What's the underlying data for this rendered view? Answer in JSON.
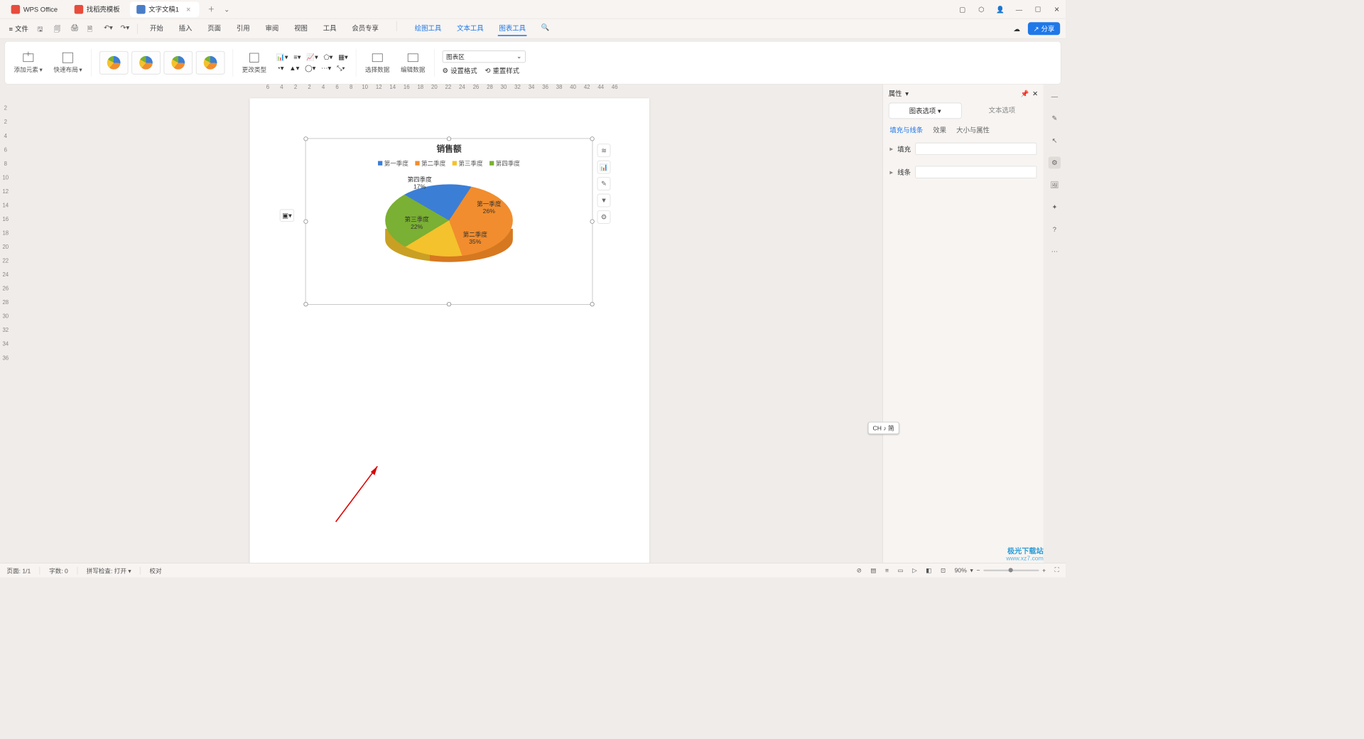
{
  "titlebar": {
    "tabs": [
      {
        "label": "WPS Office",
        "icon": "wps"
      },
      {
        "label": "找稻壳模板",
        "icon": "tpl"
      },
      {
        "label": "文字文稿1",
        "icon": "doc",
        "active": true
      }
    ]
  },
  "menubar": {
    "file": "文件",
    "items": [
      "开始",
      "插入",
      "页面",
      "引用",
      "审阅",
      "视图",
      "工具",
      "会员专享"
    ],
    "blue_items": [
      "绘图工具",
      "文本工具",
      "图表工具"
    ],
    "active": "图表工具"
  },
  "ribbon": {
    "add_element": "添加元素",
    "quick_layout": "快速布局",
    "change_type": "更改类型",
    "select_data": "选择数据",
    "edit_data": "编辑数据",
    "set_format": "设置格式",
    "reset_style": "重置样式",
    "area_select": "图表区"
  },
  "ruler_h": [
    "6",
    "4",
    "2",
    "2",
    "4",
    "6",
    "8",
    "10",
    "12",
    "14",
    "16",
    "18",
    "20",
    "22",
    "24",
    "26",
    "28",
    "30",
    "32",
    "34",
    "36",
    "38",
    "40",
    "42",
    "44",
    "46"
  ],
  "ruler_v": [
    "2",
    "2",
    "4",
    "6",
    "8",
    "10",
    "12",
    "14",
    "16",
    "18",
    "20",
    "22",
    "24",
    "26",
    "28",
    "30",
    "32",
    "34",
    "36"
  ],
  "chart_data": {
    "type": "pie",
    "title": "销售额",
    "series_name": "销售额",
    "categories": [
      "第一季度",
      "第二季度",
      "第三季度",
      "第四季度"
    ],
    "values": [
      26,
      35,
      22,
      17
    ],
    "labels": [
      "第一季度\n26%",
      "第二季度\n35%",
      "第三季度\n22%",
      "第四季度\n17%"
    ],
    "colors": [
      "#3b7ed6",
      "#f18d2e",
      "#f4c22c",
      "#7ab033"
    ],
    "legend_position": "top",
    "style": "3d-exploded"
  },
  "rpane": {
    "title": "属性",
    "tab_chart": "图表选项",
    "tab_text": "文本选项",
    "sub_fill": "填充与线条",
    "sub_effect": "效果",
    "sub_size": "大小与属性",
    "row_fill": "填充",
    "row_line": "线条"
  },
  "ime": "CH ♪ 简",
  "status": {
    "page": "页面: 1/1",
    "words": "字数: 0",
    "spell": "拼写检查: 打开",
    "proof": "校对",
    "zoom": "90%"
  },
  "watermark": {
    "l1": "极光下载站",
    "l2": "www.xz7.com"
  }
}
